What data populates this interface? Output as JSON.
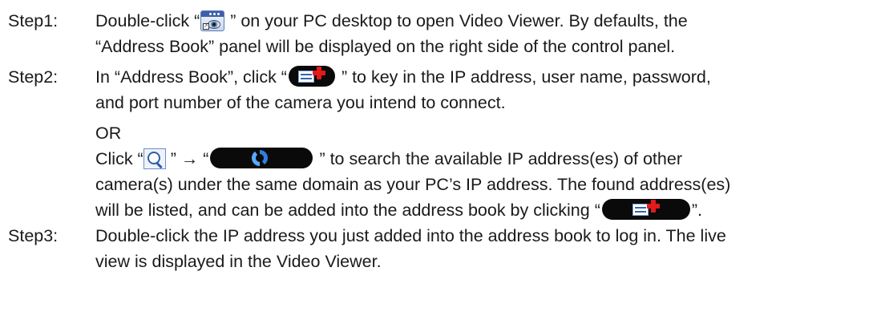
{
  "steps": [
    {
      "label": "Step1:",
      "line1_before": "Double-click “",
      "line1_after": " ” on your PC desktop to open Video Viewer. By defaults, the",
      "line2": "“Address Book” panel will be displayed on the right side of the control panel.",
      "icon": "video-viewer-icon"
    },
    {
      "label": "Step2:",
      "line1_before": "In “Address Book”, click “",
      "line1_after": " ” to key in the IP address, user name, password,",
      "line2": "and port number of the camera you intend to connect.",
      "or": "OR",
      "line4_before": "Click “",
      "line4_mid": " ” → “",
      "line4_after": " ” to search the available IP address(es) of other",
      "line5": "camera(s) under the same domain as your PC’s IP address. The found address(es)",
      "line6_before": "will be listed, and can be added into the address book by clicking “",
      "line6_after": "”.",
      "icons": [
        "add-address-icon",
        "search-icon",
        "refresh-icon",
        "add-address-icon"
      ]
    },
    {
      "label": "Step3:",
      "line1": "Double-click the IP address you just added into the address book to log in. The live",
      "line2": "view is displayed in the Video Viewer."
    }
  ]
}
